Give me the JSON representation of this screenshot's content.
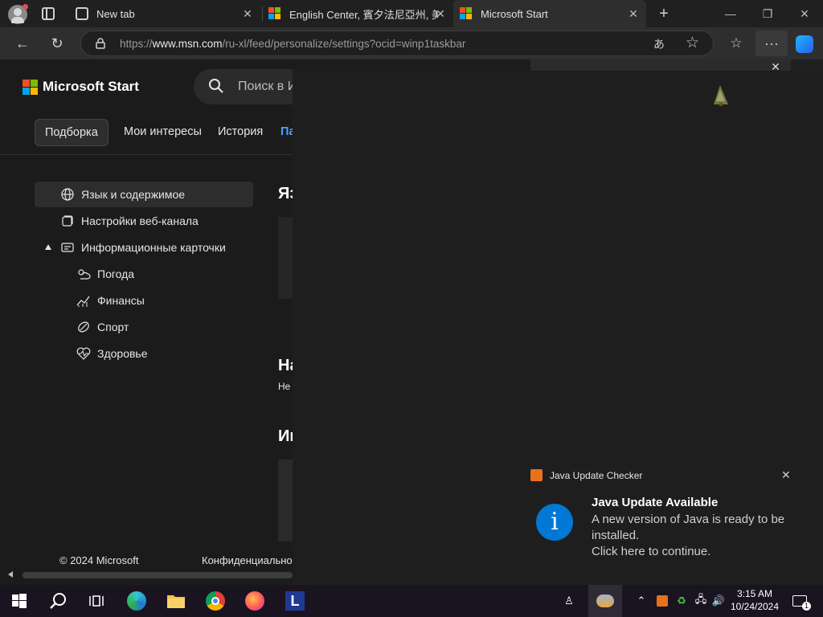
{
  "browser": {
    "tabs": [
      {
        "title": "New tab"
      },
      {
        "title": "English Center, 賓夕法尼亞州, 美國"
      },
      {
        "title": "Microsoft Start"
      }
    ],
    "url_prefix": "https://",
    "url_host": "www.msn.com",
    "url_path": "/ru-xl/feed/personalize/settings?ocid=winp1taskbar"
  },
  "msn": {
    "brand": "Microsoft Start",
    "search_placeholder": "Поиск в И",
    "pivots": [
      "Подборка",
      "Мои интересы",
      "История",
      "Па"
    ],
    "nav": [
      {
        "label": "Язык и содержимое",
        "icon": "globe-icon"
      },
      {
        "label": "Настройки веб-канала",
        "icon": "window-icon"
      },
      {
        "label": "Информационные карточки",
        "icon": "cards-icon"
      },
      {
        "label": "Погода",
        "icon": "weather-icon"
      },
      {
        "label": "Финансы",
        "icon": "chart-icon"
      },
      {
        "label": "Спорт",
        "icon": "sport-icon"
      },
      {
        "label": "Здоровье",
        "icon": "health-icon"
      }
    ],
    "heading_frags": [
      "Яз",
      "На",
      "Не",
      "Ин"
    ],
    "footer_copyright": "© 2024 Microsoft",
    "footer_privacy": "Конфиденциально"
  },
  "toast": {
    "app": "Java Update Checker",
    "title": "Java Update Available",
    "body": "A new version of Java is ready to be installed.",
    "action": "Click here to continue."
  },
  "taskbar": {
    "time": "3:15 AM",
    "date": "10/24/2024",
    "notification_count": "1"
  },
  "colors": {
    "accent": "#0078d4",
    "taskbar": "#1a1320",
    "java": "#e8721c"
  }
}
